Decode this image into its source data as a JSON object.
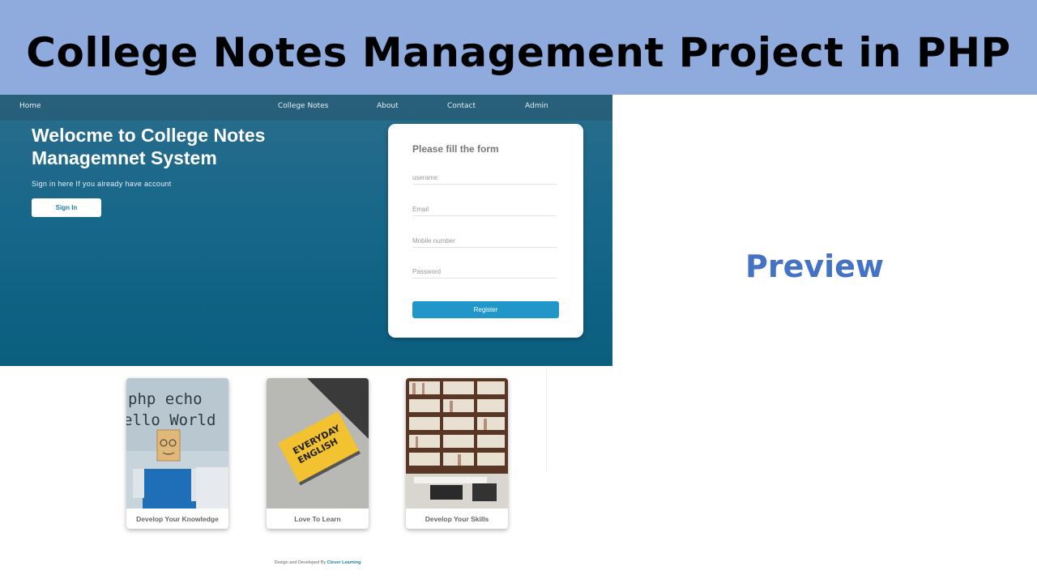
{
  "banner": {
    "title": "College Notes Management Project in PHP"
  },
  "navbar": {
    "items": [
      {
        "label": "Home"
      },
      {
        "label": "College Notes"
      },
      {
        "label": "About"
      },
      {
        "label": "Contact"
      },
      {
        "label": "Admin"
      }
    ]
  },
  "hero": {
    "heading": "Welocme to College Notes Managemnet System",
    "subtext": "Sign in here If you already have account",
    "signin_label": "Sign In"
  },
  "form": {
    "title": "Please fill the form",
    "fields": [
      {
        "placeholder": "userame"
      },
      {
        "placeholder": "Email"
      },
      {
        "placeholder": "Mobile number"
      },
      {
        "placeholder": "Password"
      }
    ],
    "register_label": "Register"
  },
  "cards": [
    {
      "label": "Develop Your Knowledge",
      "image": "php-echo-hello-world-figure"
    },
    {
      "label": "Love To Learn",
      "image": "everyday-english-book"
    },
    {
      "label": "Develop Your Skills",
      "image": "library-bookshelves"
    }
  ],
  "card_art": {
    "php_line1": "php echo",
    "php_line2": "ello World",
    "book_line1": "EVERYDAY",
    "book_line2": "ENGLISH"
  },
  "footer": {
    "text": "Design and Developed By ",
    "brand": "Clever Learning"
  },
  "side_label": "Preview",
  "colors": {
    "banner_bg": "#8faadc",
    "hero_bg": "#17678a",
    "register_button": "#2196c9",
    "preview_text": "#4472c4"
  }
}
